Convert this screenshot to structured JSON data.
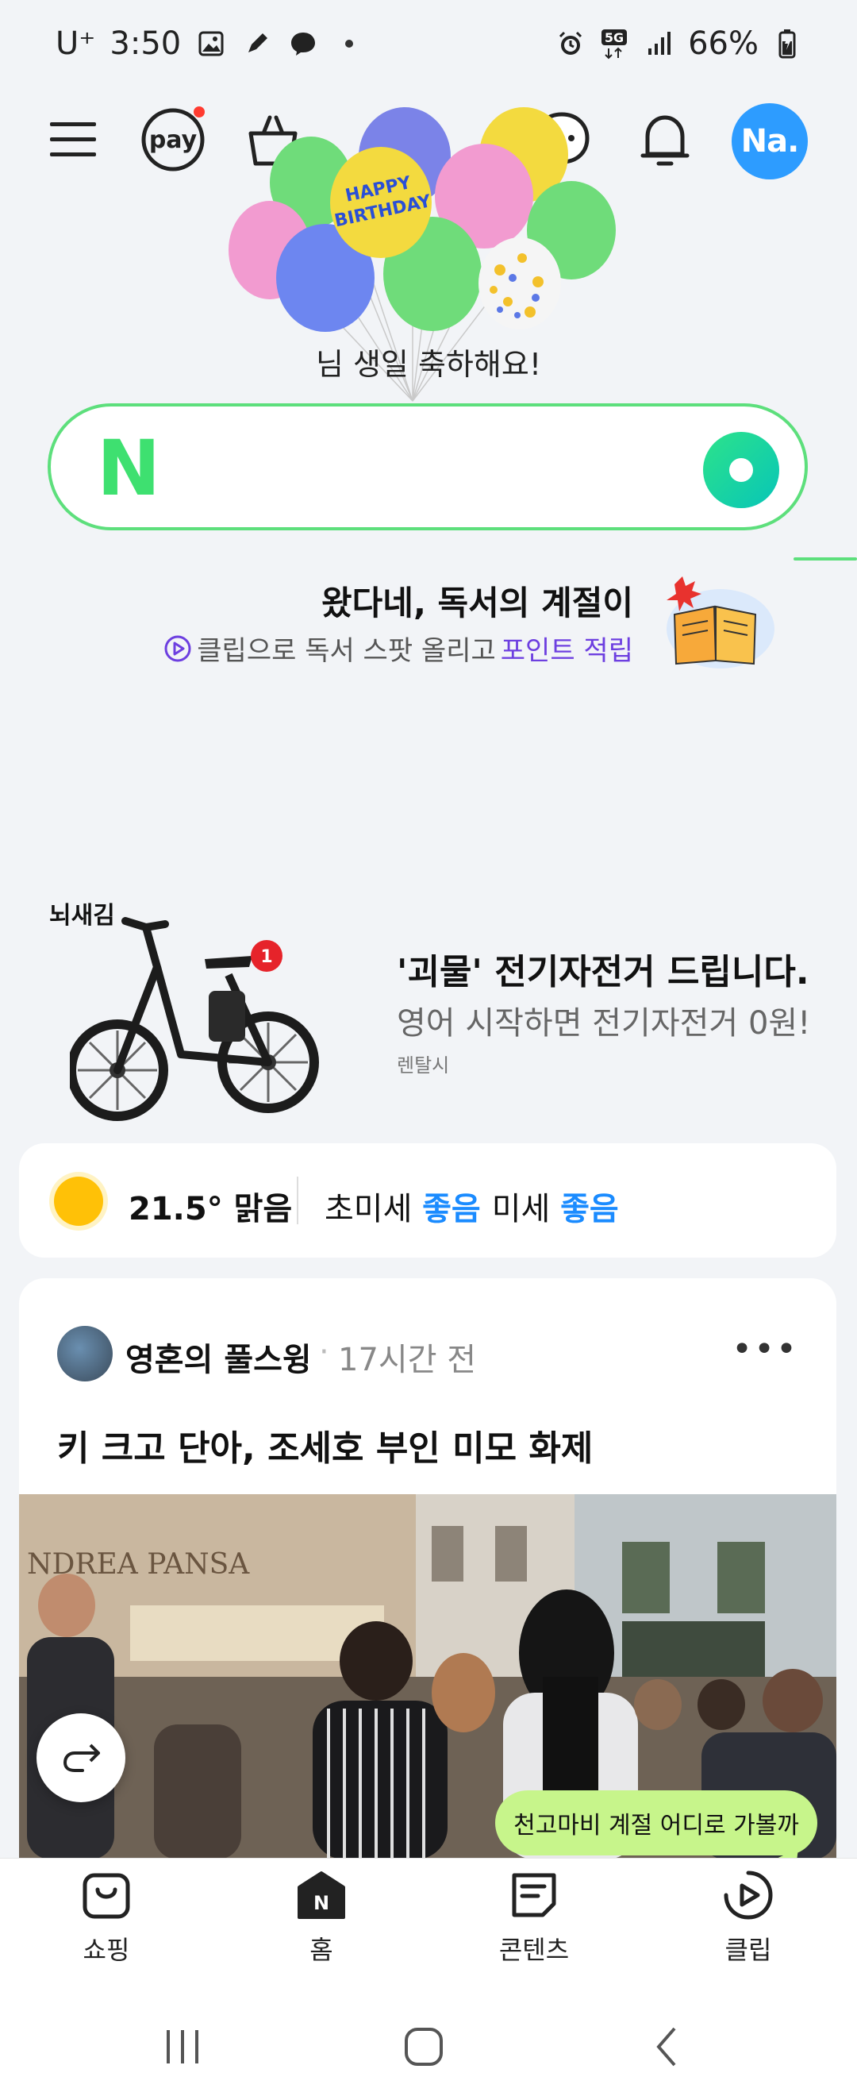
{
  "status_bar": {
    "carrier": "U⁺",
    "time": "3:50",
    "network": "5G",
    "battery": "66%",
    "icons": [
      "gallery-icon",
      "edit-icon",
      "messenger-icon",
      "dot-icon",
      "alarm-icon",
      "network-5g-icon",
      "signal-icon",
      "battery-icon"
    ]
  },
  "header": {
    "menu_icon": "menu-icon",
    "pay_label": "pay",
    "shopping_icon": "shopping-bag-icon",
    "chat_icon": "chat-icon",
    "bell_icon": "bell-icon",
    "avatar_text": "Na."
  },
  "birthday": {
    "message": "님 생일 축하해요!",
    "balloon_text": "HAPPY BIRTHDAY"
  },
  "search": {
    "logo": "N"
  },
  "promo": {
    "title": "왔다네, 독서의 계절이",
    "sub_plain": "클립으로 독서 스팟 올리고 ",
    "sub_highlight": "포인트 적립"
  },
  "bike_ad": {
    "logo": "뇌새김",
    "badge": "1",
    "title": "'괴물' 전기자전거 드립니다.",
    "subtitle": "영어 시작하면 전기자전거 0원!",
    "tag": "렌탈시"
  },
  "weather": {
    "temp_condition": "21.5° 맑음",
    "fine_dust_label": "초미세",
    "fine_dust_value": "좋음",
    "dust_label": "미세",
    "dust_value": "좋음"
  },
  "feed": {
    "author": "영혼의 풀스윙",
    "separator": "·",
    "time_ago": "17시간 전",
    "more": "•••",
    "headline": "키 크고 단아, 조세호 부인 미모 화제",
    "photo_sign": "NDREA PANSA"
  },
  "tooltip": {
    "text": "천고마비 계절 어디로 가볼까"
  },
  "bottom_nav": {
    "items": [
      {
        "label": "쇼핑",
        "icon": "shopping-icon"
      },
      {
        "label": "홈",
        "icon": "home-n-icon"
      },
      {
        "label": "콘텐츠",
        "icon": "contents-icon"
      },
      {
        "label": "클립",
        "icon": "clip-play-icon"
      }
    ]
  },
  "colors": {
    "brand_green": "#3ee070",
    "accent_blue": "#1a8bff",
    "avatar_blue": "#2d9cff",
    "tooltip_green": "#c7f58b",
    "highlight_purple": "#6d3fe0"
  }
}
